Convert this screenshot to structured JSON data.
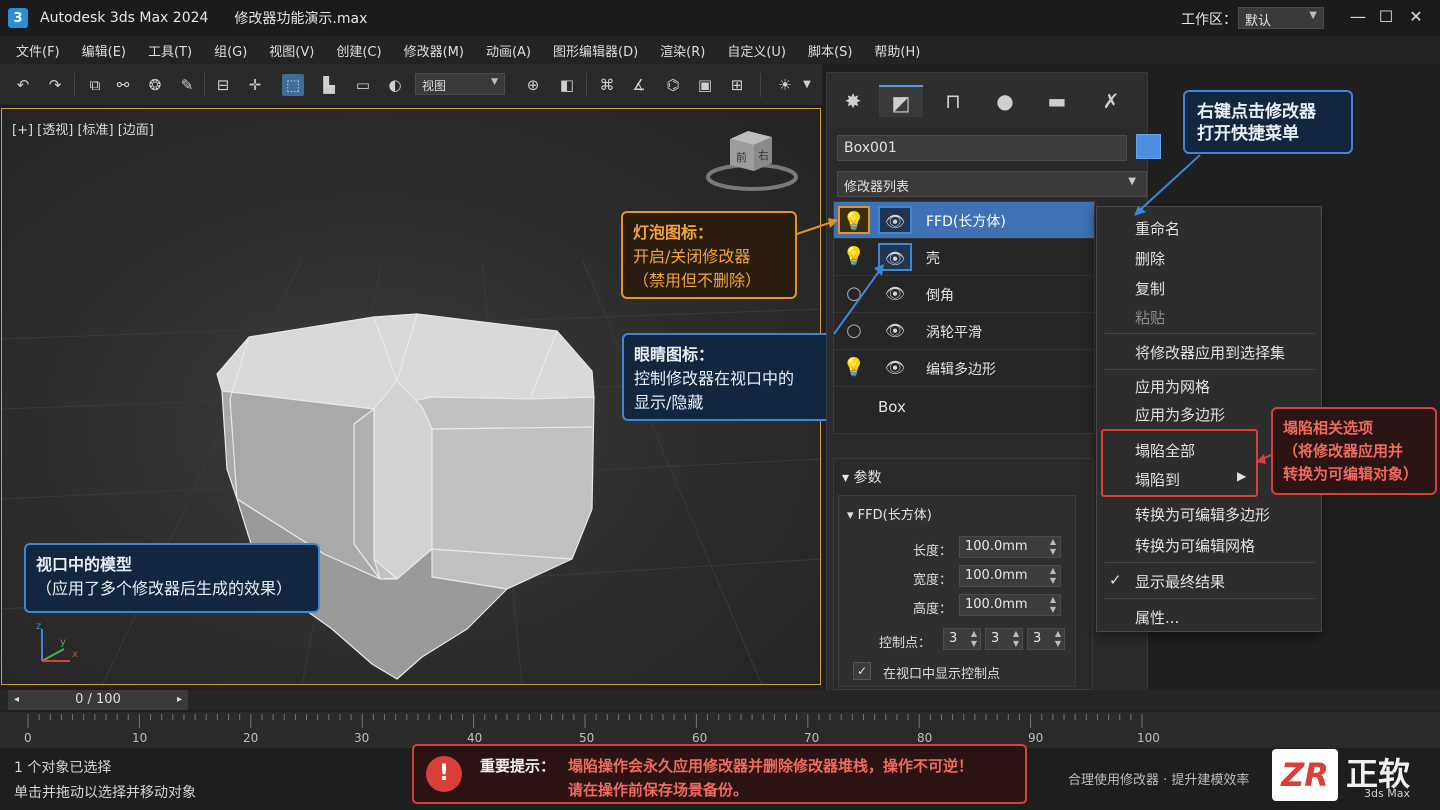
{
  "titlebar": {
    "app_icon": "3",
    "app_title": "Autodesk 3ds Max 2024",
    "file_title": "修改器功能演示.max",
    "workspace_label": "工作区：",
    "workspace_value": "默认",
    "minimize": "—",
    "maximize": "☐",
    "close": "✕"
  },
  "menu": [
    "文件(F)",
    "编辑(E)",
    "工具(T)",
    "组(G)",
    "视图(V)",
    "创建(C)",
    "修改器(M)",
    "动画(A)",
    "图形编辑器(D)",
    "渲染(R)",
    "自定义(U)",
    "脚本(S)",
    "帮助(H)"
  ],
  "toolbar": {
    "view_select": "视图"
  },
  "viewport": {
    "label": "[+] [透视] [标准] [边面]",
    "cube_front": "前",
    "cube_right": "右",
    "axis_z": "z",
    "axis_y": "y",
    "axis_x": "x"
  },
  "callouts": {
    "right_click": {
      "line1": "右键点击修改器",
      "line2": "打开快捷菜单"
    },
    "bulb": {
      "line1": "灯泡图标：",
      "line2": "开启/关闭修改器",
      "line3": "（禁用但不删除）"
    },
    "eye": {
      "line1": "眼睛图标：",
      "line2": "控制修改器在视口中的",
      "line3": "显示/隐藏"
    },
    "collapse": {
      "line1": "塌陷相关选项",
      "line2": "（将修改器应用并",
      "line3": "转换为可编辑对象）"
    },
    "model": {
      "line1": "视口中的模型",
      "line2": "（应用了多个修改器后生成的效果）"
    }
  },
  "command_panel": {
    "object_name": "Box001",
    "object_color": "#4e8ee0",
    "modifier_list": "修改器列表",
    "stack": [
      {
        "name": "FFD(长方体)",
        "selected": true
      },
      {
        "name": "壳",
        "selected": false
      },
      {
        "name": "倒角",
        "selected": false
      },
      {
        "name": "涡轮平滑",
        "selected": false
      },
      {
        "name": "编辑多边形",
        "selected": false
      }
    ],
    "base_object": "Box",
    "params": {
      "title": "参数",
      "group": "FFD(长方体)",
      "length_label": "长度：",
      "length": "100.0mm",
      "width_label": "宽度：",
      "width": "100.0mm",
      "height_label": "高度：",
      "height": "100.0mm",
      "control_points_label": "控制点：",
      "cp1": "3",
      "cp2": "3",
      "cp3": "3",
      "show_cp_label": "在视口中显示控制点"
    }
  },
  "context_menu": {
    "items": [
      "重命名",
      "删除",
      "复制",
      "粘贴",
      "将修改器应用到选择集",
      "应用为网格",
      "应用为多边形",
      "塌陷全部",
      "塌陷到",
      "转换为可编辑多边形",
      "转换为可编辑网格",
      "显示最终结果",
      "属性..."
    ]
  },
  "timeline": {
    "frame": "0 / 100",
    "ticks": [
      "0",
      "10",
      "20",
      "30",
      "40",
      "50",
      "60",
      "70",
      "80",
      "90",
      "100"
    ]
  },
  "status": {
    "line1": "1 个对象已选择",
    "line2": "单击并拖动以选择并移动对象",
    "warning_title": "重要提示：",
    "warning_line1": "塌陷操作会永久应用修改器并删除修改器堆栈，操作不可逆！",
    "warning_line2": "请在操作前保存场景备份。",
    "tagline": "合理使用修改器 · 提升建模效率",
    "logo_mark": "ZR",
    "logo_text": "正软",
    "logo_sub": "3ds Max"
  },
  "colors": {
    "accent_blue": "#3f86d6",
    "callout_orange": "#e5922a",
    "callout_red": "#d9403a",
    "selected_row": "#3f72b4"
  }
}
